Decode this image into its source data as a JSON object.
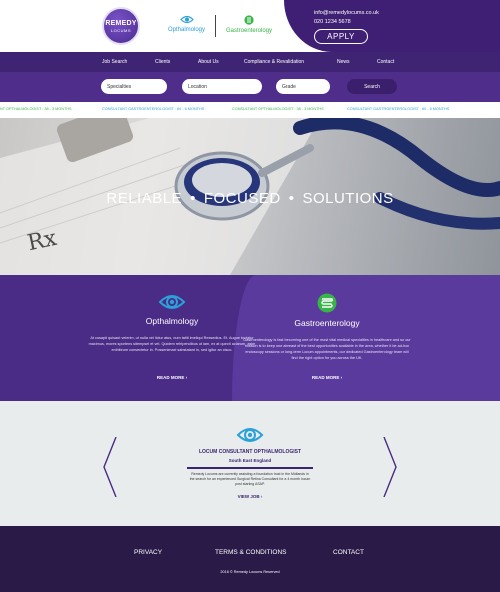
{
  "header": {
    "logo_main": "REMEDY",
    "logo_sub": "LOCUMS",
    "specialties": [
      {
        "label": "Opthalmology",
        "icon": "eye-icon",
        "color": "#2aa1d8"
      },
      {
        "label": "Gastroenterology",
        "icon": "stomach-icon",
        "color": "#38b449"
      }
    ],
    "email": "info@remedylocums.co.uk",
    "phone": "020 1234 5678",
    "apply_label": "APPLY"
  },
  "nav": [
    "Job Search",
    "Clients",
    "About Us",
    "Compliance & Revalidation",
    "News",
    "Contact"
  ],
  "search": {
    "specialties": "Specialties",
    "location": "Location",
    "grade": "Grade",
    "button": "Search"
  },
  "ticker": [
    {
      "text": "NT OPTHALMOLOGIST : 38 - 3 MONTHS",
      "color": "#38b449"
    },
    {
      "text": "CONSULTANT GASTROENTEROLOGIST : 60 - 6 MONTHS",
      "color": "#2aa1d8"
    },
    {
      "text": "CONSULTANT OPTHALMOLOGIST : 38 - 3 MONTHS",
      "color": "#38b449"
    },
    {
      "text": "CONSULTANT GASTROENTEROLOGIST : 60 - 6 MONTHS",
      "color": "#2aa1d8"
    }
  ],
  "hero": {
    "w1": "RELIABLE",
    "w2": "FOCUSED",
    "w3": "SOLUTIONS",
    "bullet": "•"
  },
  "specialty_cards": [
    {
      "title": "Opthalmology",
      "icon": "eye-icon",
      "icon_color": "#2aa1d8",
      "description": "At cusapit quisaut velerim, ut nulla vel lictur atus, num tatlit imeliqui Ressedius. Et. Augue toctatur maximus, mores sportens sitempsel et vel. Quidem rehtpendibus ut iam, ex at quecti aciarum, asim enihiteum consectetur in. Possenimaxi sabstatant in, sed igitur an cisco.",
      "read_more": "READ MORE  ›"
    },
    {
      "title": "Gastroenterology",
      "icon": "stomach-icon",
      "icon_color": "#38b449",
      "description": "Gastroenterology is fast becoming one of the most vital medical specialties in healthcare and so our mission is to keep one abreast of the best opportunities available in the area, whether it be ad-hoc endoscopy sessions or long-term Locum appointments, our dedicated Gastroenterology team will find the right option for you across the UK.",
      "read_more": "READ MORE  ›"
    }
  ],
  "job": {
    "title": "LOCUM CONSULTANT OPTHALMOLOGIST",
    "location": "South East England",
    "description": "Remedy Locums are currently assisting a foundation trust in the Midlands in the search for an experienced Surgical Retina Consultant for a 4 month locum post starting ASAP.",
    "link": "VIEW JOB  ›"
  },
  "footer": {
    "privacy": "PRIVACY",
    "terms": "TERMS & CONDITIONS",
    "contact": "CONTACT",
    "copyright": "2016 © Remedy Locums Reserved"
  },
  "colors": {
    "primary": "#3f2474",
    "accent_blue": "#2aa1d8",
    "accent_green": "#38b449"
  }
}
